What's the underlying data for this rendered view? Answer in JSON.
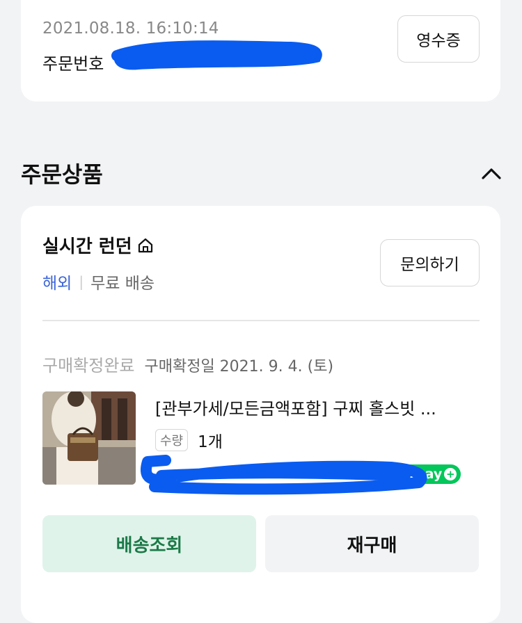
{
  "order": {
    "datetime": "2021.08.18. 16:10:14",
    "order_number_label": "주문번호",
    "receipt_label": "영수증"
  },
  "section": {
    "title": "주문상품",
    "toggle_icon": "chevron-up-icon"
  },
  "shop": {
    "name": "실시간 런던",
    "icon": "house-icon",
    "origin": "해외",
    "shipping": "무료 배송",
    "inquiry_label": "문의하기"
  },
  "item": {
    "status": "구매확정완료",
    "confirm_date": "구매확정일 2021. 9. 4. (토)",
    "name": "[관부가세/모든금액포함] 구찌 홀스빗 ...",
    "qty_label": "수량",
    "qty_value": "1개",
    "pay_badge": "pay"
  },
  "actions": {
    "track_label": "배송조회",
    "rebuy_label": "재구매"
  },
  "colors": {
    "accent_blue": "#3b64d6",
    "track_green": "#1b7a48",
    "npay_green": "#03c75a",
    "redaction_blue": "#0a5cf0"
  }
}
